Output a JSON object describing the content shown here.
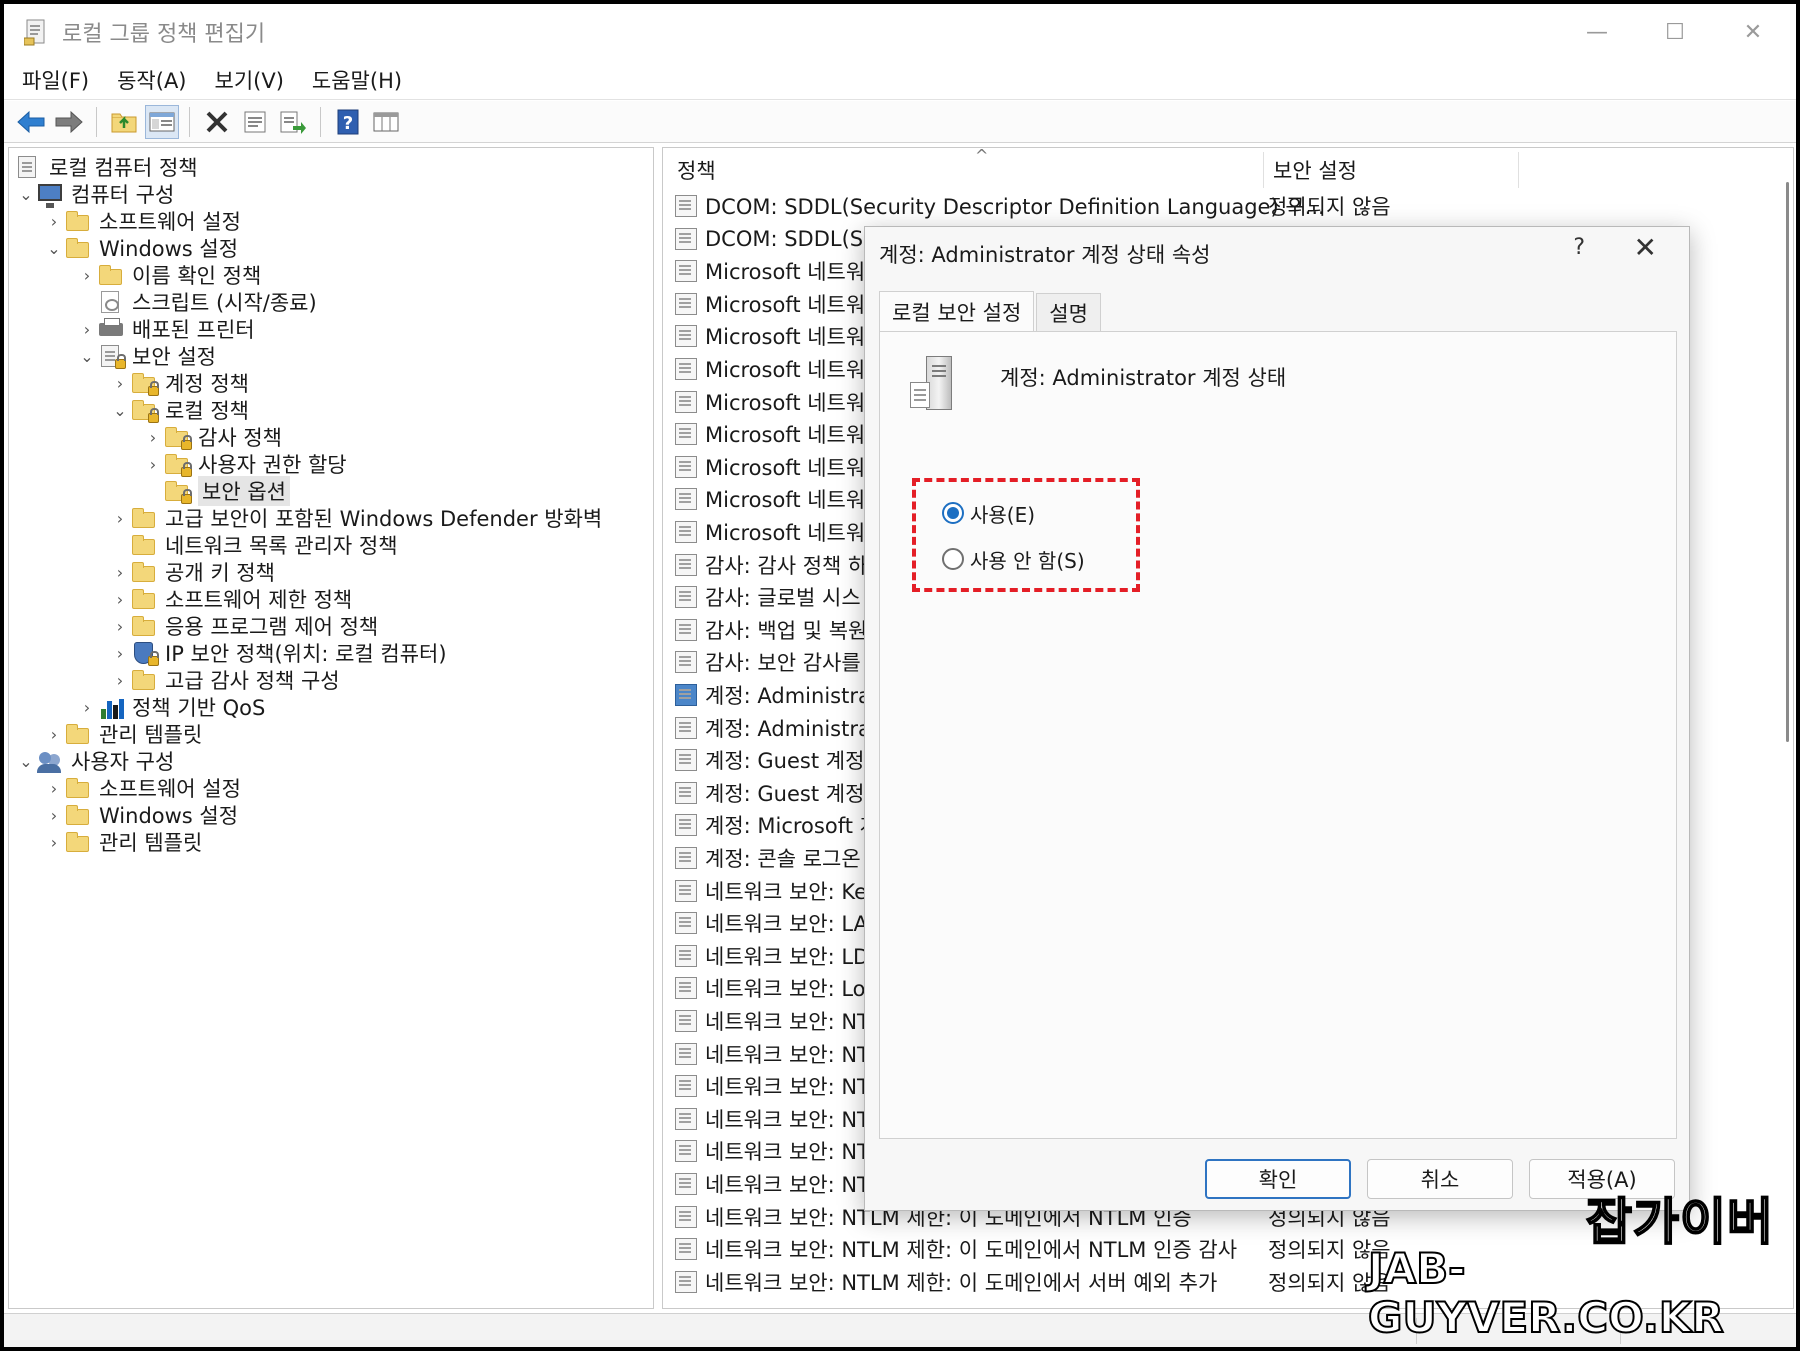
{
  "window": {
    "title": "로컬 그룹 정책 편집기",
    "minimize": "—",
    "maximize": "☐",
    "close": "✕"
  },
  "menu": [
    "파일(F)",
    "동작(A)",
    "보기(V)",
    "도움말(H)"
  ],
  "toolbar_icons": [
    "back-arrow-icon",
    "forward-arrow-icon",
    "up-folder-icon",
    "show-hide-tree-icon",
    "delete-icon",
    "properties-icon",
    "export-list-icon",
    "help-icon",
    "extended-view-icon"
  ],
  "tree": [
    {
      "label": "로컬 컴퓨터 정책",
      "icon": "policy-doc-icon",
      "expander": ""
    },
    {
      "label": "컴퓨터 구성",
      "icon": "computer-icon",
      "expander": "⌄"
    },
    {
      "label": "소프트웨어 설정",
      "icon": "folder-icon",
      "expander": "›"
    },
    {
      "label": "Windows 설정",
      "icon": "folder-icon",
      "expander": "⌄"
    },
    {
      "label": "이름 확인 정책",
      "icon": "folder-icon",
      "expander": "›"
    },
    {
      "label": "스크립트 (시작/종료)",
      "icon": "script-icon",
      "expander": ""
    },
    {
      "label": "배포된 프린터",
      "icon": "printer-icon",
      "expander": "›"
    },
    {
      "label": "보안 설정",
      "icon": "security-icon",
      "expander": "⌄"
    },
    {
      "label": "계정 정책",
      "icon": "locked-folder-icon",
      "expander": "›"
    },
    {
      "label": "로컬 정책",
      "icon": "locked-folder-icon",
      "expander": "⌄"
    },
    {
      "label": "감사 정책",
      "icon": "locked-folder-icon",
      "expander": "›"
    },
    {
      "label": "사용자 권한 할당",
      "icon": "locked-folder-icon",
      "expander": "›"
    },
    {
      "label": "보안 옵션",
      "icon": "locked-folder-icon",
      "expander": ""
    },
    {
      "label": "고급 보안이 포함된 Windows Defender 방화벽",
      "icon": "folder-icon",
      "expander": "›"
    },
    {
      "label": "네트워크 목록 관리자 정책",
      "icon": "folder-icon",
      "expander": ""
    },
    {
      "label": "공개 키 정책",
      "icon": "folder-icon",
      "expander": "›"
    },
    {
      "label": "소프트웨어 제한 정책",
      "icon": "folder-icon",
      "expander": "›"
    },
    {
      "label": "응용 프로그램 제어 정책",
      "icon": "folder-icon",
      "expander": "›"
    },
    {
      "label": "IP 보안 정책(위치: 로컬 컴퓨터)",
      "icon": "ip-security-icon",
      "expander": "›"
    },
    {
      "label": "고급 감사 정책 구성",
      "icon": "folder-icon",
      "expander": "›"
    },
    {
      "label": "정책 기반 QoS",
      "icon": "qos-chart-icon",
      "expander": "›"
    },
    {
      "label": "관리 템플릿",
      "icon": "folder-icon",
      "expander": "›"
    },
    {
      "label": "사용자 구성",
      "icon": "users-icon",
      "expander": "⌄"
    },
    {
      "label": "소프트웨어 설정",
      "icon": "folder-icon",
      "expander": "›"
    },
    {
      "label": "Windows 설정",
      "icon": "folder-icon",
      "expander": "›"
    },
    {
      "label": "관리 템플릿",
      "icon": "folder-icon",
      "expander": "›"
    }
  ],
  "list": {
    "col_policy": "정책",
    "col_setting": "보안 설정",
    "sort_indicator": "^",
    "rows": [
      {
        "policy": "DCOM: SDDL(Security Descriptor Definition Language) 구...",
        "setting": "정의되지 않음"
      },
      {
        "policy": "DCOM: SDDL(Se",
        "setting": ""
      },
      {
        "policy": "Microsoft 네트워",
        "setting": ""
      },
      {
        "policy": "Microsoft 네트워",
        "setting": ""
      },
      {
        "policy": "Microsoft 네트워",
        "setting": ""
      },
      {
        "policy": "Microsoft 네트워",
        "setting": ""
      },
      {
        "policy": "Microsoft 네트워",
        "setting": ""
      },
      {
        "policy": "Microsoft 네트워",
        "setting": ""
      },
      {
        "policy": "Microsoft 네트워",
        "setting": ""
      },
      {
        "policy": "Microsoft 네트워",
        "setting": ""
      },
      {
        "policy": "Microsoft 네트워",
        "setting": ""
      },
      {
        "policy": "감사: 감사 정책 하",
        "setting": ""
      },
      {
        "policy": "감사: 글로벌 시스",
        "setting": ""
      },
      {
        "policy": "감사: 백업 및 복원",
        "setting": ""
      },
      {
        "policy": "감사: 보안 감사를",
        "setting": ""
      },
      {
        "policy": "계정: Administrat",
        "setting": ""
      },
      {
        "policy": "계정: Administrat",
        "setting": ""
      },
      {
        "policy": "계정: Guest 계정",
        "setting": ""
      },
      {
        "policy": "계정: Guest 계정",
        "setting": ""
      },
      {
        "policy": "계정: Microsoft 계",
        "setting": ""
      },
      {
        "policy": "계정: 콘솔 로그온",
        "setting": ""
      },
      {
        "policy": "네트워크 보안: Ke",
        "setting": ""
      },
      {
        "policy": "네트워크 보안: LA",
        "setting": ""
      },
      {
        "policy": "네트워크 보안: LD",
        "setting": ""
      },
      {
        "policy": "네트워크 보안: Lo",
        "setting": ""
      },
      {
        "policy": "네트워크 보안: NT",
        "setting": ""
      },
      {
        "policy": "네트워크 보안: NT",
        "setting": ""
      },
      {
        "policy": "네트워크 보안: NT",
        "setting": ""
      },
      {
        "policy": "네트워크 보안: NT",
        "setting": ""
      },
      {
        "policy": "네트워크 보안: NT",
        "setting": ""
      },
      {
        "policy": "네트워크 보안: NT",
        "setting": ""
      },
      {
        "policy": "네트워크 보안: NTLM 제한: 이 도메인에서 NTLM 인증",
        "setting": "정의되지 않음"
      },
      {
        "policy": "네트워크 보안: NTLM 제한: 이 도메인에서 NTLM 인증 감사",
        "setting": "정의되지 않음"
      },
      {
        "policy": "네트워크 보안: NTLM 제한: 이 도메인에서 서버 예외 추가",
        "setting": "정의되지 않음"
      }
    ]
  },
  "dialog": {
    "title": "계정: Administrator 계정 상태 속성",
    "help": "?",
    "close": "✕",
    "tabs": [
      "로컬 보안 설정",
      "설명"
    ],
    "policy_name": "계정: Administrator 계정 상태",
    "options": [
      {
        "label": "사용(E)",
        "checked": true
      },
      {
        "label": "사용 안 함(S)",
        "checked": false
      }
    ],
    "buttons": {
      "ok": "확인",
      "cancel": "취소",
      "apply": "적용(A)"
    },
    "highlight_color": "#e41e26"
  },
  "watermark": {
    "line1": "잡가이버",
    "line2": "JAB-GUYVER.CO.KR"
  }
}
